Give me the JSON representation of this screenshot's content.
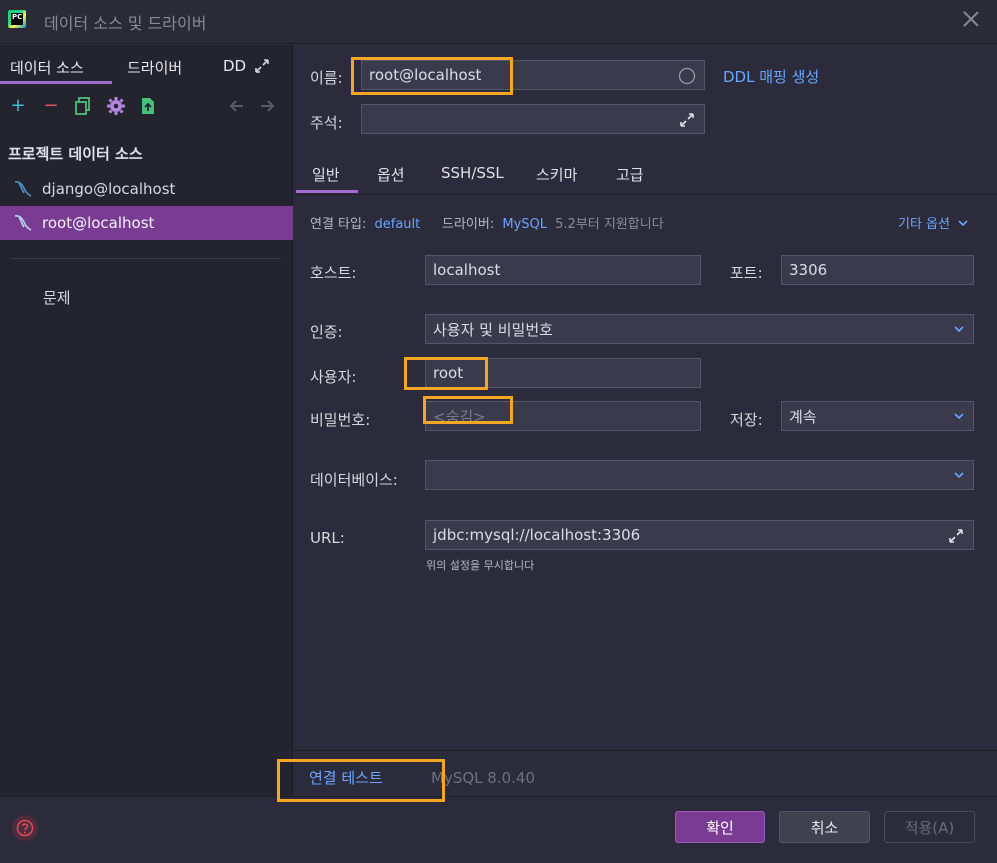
{
  "window": {
    "title": "데이터 소스 및 드라이버"
  },
  "sidebar": {
    "tabs": [
      "데이터 소스",
      "드라이버",
      "DD"
    ],
    "section_header": "프로젝트 데이터 소스",
    "items": [
      {
        "label": "django@localhost"
      },
      {
        "label": "root@localhost"
      }
    ],
    "problems": "문제"
  },
  "form": {
    "name_label": "이름:",
    "name_value": "root@localhost",
    "ddl_link": "DDL 매핑 생성",
    "comment_label": "주석:",
    "comment_value": ""
  },
  "tabs": [
    "일반",
    "옵션",
    "SSH/SSL",
    "스키마",
    "고급"
  ],
  "connection": {
    "type_label": "연결 타입:",
    "type_value": "default",
    "driver_label": "드라이버:",
    "driver_value": "MySQL",
    "driver_note": "5.2부터 지원합니다",
    "more_options": "기타 옵션"
  },
  "general": {
    "host_label": "호스트:",
    "host_value": "localhost",
    "port_label": "포트:",
    "port_value": "3306",
    "auth_label": "인증:",
    "auth_value": "사용자 및 비밀번호",
    "user_label": "사용자:",
    "user_value": "root",
    "password_label": "비밀번호:",
    "password_placeholder": "<숨김>",
    "save_label": "저장:",
    "save_value": "계속",
    "database_label": "데이터베이스:",
    "database_value": "",
    "url_label": "URL:",
    "url_value": "jdbc:mysql://localhost:3306",
    "url_note": "위의 설정을 무시합니다"
  },
  "bottom": {
    "test_connection": "연결 테스트",
    "version": "MySQL 8.0.40"
  },
  "footer": {
    "ok": "확인",
    "cancel": "취소",
    "apply": "적용(A)"
  },
  "colors": {
    "accent": "#7a3c93",
    "link": "#6aa5ff",
    "highlight": "#f5a623"
  }
}
